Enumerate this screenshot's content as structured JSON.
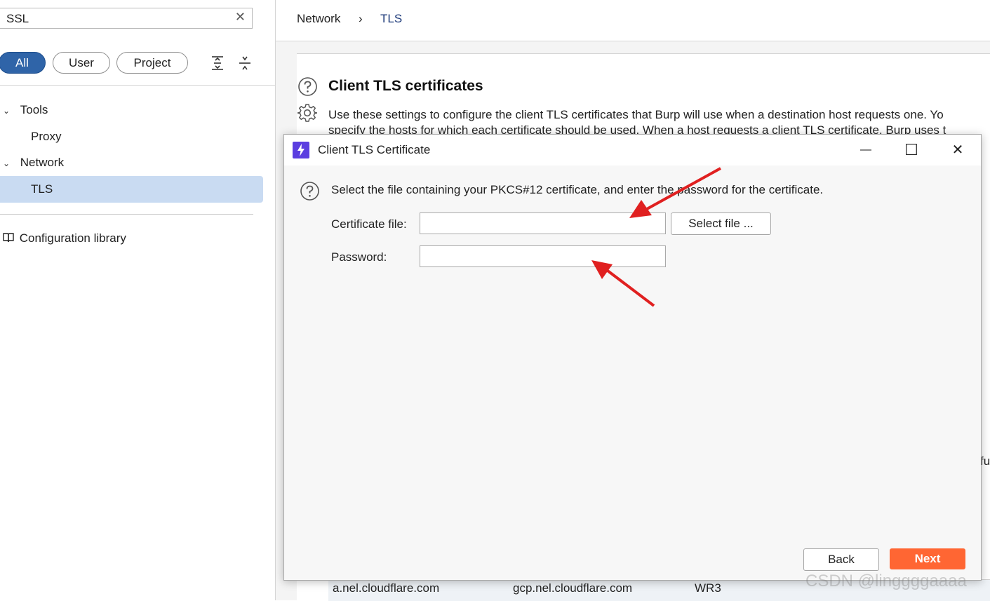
{
  "sidebar": {
    "search": {
      "value": "SSL",
      "clear_symbol": "✕"
    },
    "filters": [
      {
        "label": "All",
        "active": true
      },
      {
        "label": "User",
        "active": false
      },
      {
        "label": "Project",
        "active": false
      }
    ],
    "tree": {
      "tools": {
        "label": "Tools",
        "children": [
          "Proxy"
        ]
      },
      "network": {
        "label": "Network",
        "children": [
          "TLS"
        ]
      },
      "selected": "TLS",
      "library": {
        "label": "Configuration library",
        "icon": "book-icon"
      }
    }
  },
  "breadcrumb": {
    "parent": "Network",
    "separator": "›",
    "current": "TLS"
  },
  "section": {
    "title": "Client TLS certificates",
    "description_line1": "Use these settings to configure the client TLS certificates that Burp will use when a destination host requests one. Yo",
    "description_line2": "specify the hosts for which each certificate should be used. When a host requests a client TLS certificate, Burp uses t"
  },
  "table_row": {
    "col1": "a.nel.cloudflare.com",
    "col2": "gcp.nel.cloudflare.com",
    "col3": "WR3"
  },
  "side_fragment": "fu",
  "dialog": {
    "title": "Client TLS Certificate",
    "window_controls": {
      "minimize": "—",
      "maximize": "☐",
      "close": "✕"
    },
    "info": "Select the file containing your PKCS#12 certificate, and enter the password for the certificate.",
    "certificate_label": "Certificate file:",
    "certificate_value": "",
    "select_file_label": "Select file ...",
    "password_label": "Password:",
    "password_value": "",
    "back_label": "Back",
    "next_label": "Next"
  },
  "watermark": "CSDN @linggggaaaa",
  "colors": {
    "accent": "#2f64a8",
    "selected_row": "#c9dbf2",
    "primary_button": "#ff6633",
    "annotation_arrow": "#e02020",
    "app_icon": "#5b3ee0"
  }
}
